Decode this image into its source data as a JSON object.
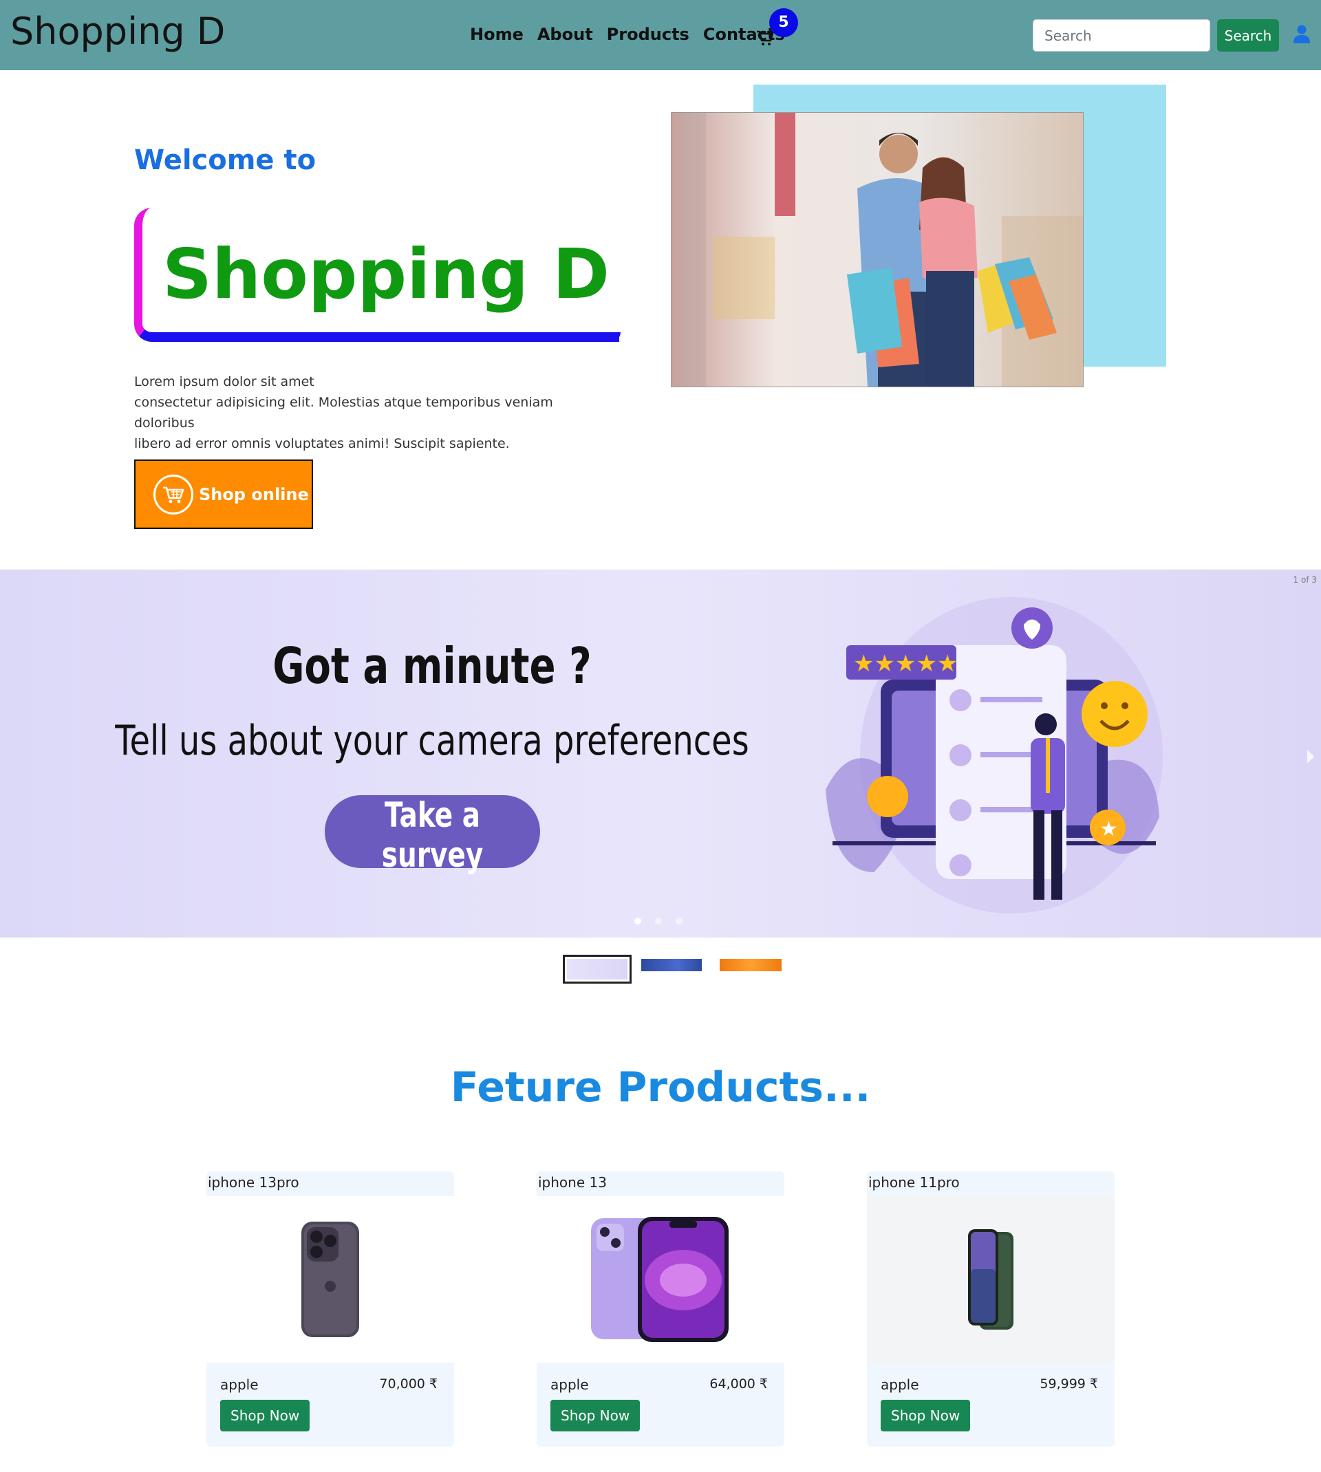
{
  "header": {
    "brand": "Shopping D",
    "nav": [
      "Home",
      "About",
      "Products",
      "Contacts"
    ],
    "cart_count": "5",
    "search_placeholder": "Search",
    "search_button": "Search"
  },
  "hero": {
    "welcome": "Welcome to",
    "title": "Shopping D",
    "description_line1": "Lorem ipsum dolor sit amet",
    "description_line2": "consectetur adipisicing elit. Molestias atque temporibus veniam doloribus",
    "description_line3": "libero ad error omnis voluptates animi! Suscipit sapiente.",
    "cta": "Shop online"
  },
  "carousel": {
    "counter": "1 of 3",
    "headline": "Got a minute ?",
    "subline": "Tell us about your camera preferences",
    "button": "Take a survey",
    "slide_count": 3,
    "active_slide": 1
  },
  "featured": {
    "title": "Feture Products...",
    "products": [
      {
        "name": "iphone 13pro",
        "brand": "apple",
        "price": "70,000 ₹",
        "button": "Shop Now"
      },
      {
        "name": "iphone 13",
        "brand": "apple",
        "price": "64,000 ₹",
        "button": "Shop Now"
      },
      {
        "name": "iphone 11pro",
        "brand": "apple",
        "price": "59,999 ₹",
        "button": "Shop Now"
      }
    ]
  },
  "colors": {
    "navbar": "#5f9ea0",
    "accent_green": "#198754",
    "hero_title": "#0f9a12",
    "welcome": "#1a6fe0",
    "cta": "#ff8c00",
    "badge": "#0a0ae6"
  }
}
